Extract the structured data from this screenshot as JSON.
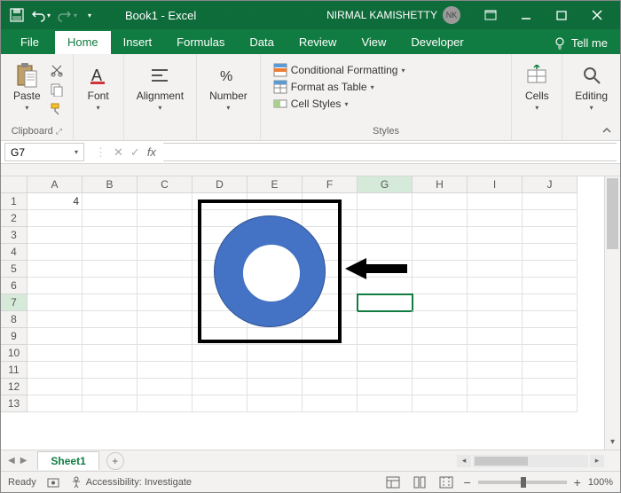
{
  "title": "Book1 - Excel",
  "user": {
    "name": "NIRMAL KAMISHETTY",
    "initials": "NK"
  },
  "tabs": {
    "file": "File",
    "home": "Home",
    "insert": "Insert",
    "formulas": "Formulas",
    "data": "Data",
    "review": "Review",
    "view": "View",
    "developer": "Developer",
    "tellme": "Tell me"
  },
  "ribbon": {
    "clipboard": {
      "paste": "Paste",
      "label": "Clipboard"
    },
    "font": {
      "btn": "Font"
    },
    "alignment": {
      "btn": "Alignment"
    },
    "number": {
      "btn": "Number"
    },
    "styles": {
      "cond": "Conditional Formatting",
      "table": "Format as Table",
      "cell": "Cell Styles",
      "label": "Styles"
    },
    "cells": {
      "btn": "Cells"
    },
    "editing": {
      "btn": "Editing"
    }
  },
  "namebox": "G7",
  "columns": [
    "A",
    "B",
    "C",
    "D",
    "E",
    "F",
    "G",
    "H",
    "I",
    "J"
  ],
  "rows": [
    "1",
    "2",
    "3",
    "4",
    "5",
    "6",
    "7",
    "8",
    "9",
    "10",
    "11",
    "12",
    "13"
  ],
  "selected_col": "G",
  "selected_row": "7",
  "cells": {
    "A1": "4"
  },
  "sheet": {
    "name": "Sheet1"
  },
  "status": {
    "ready": "Ready",
    "accessibility": "Accessibility: Investigate",
    "zoom": "100%"
  }
}
